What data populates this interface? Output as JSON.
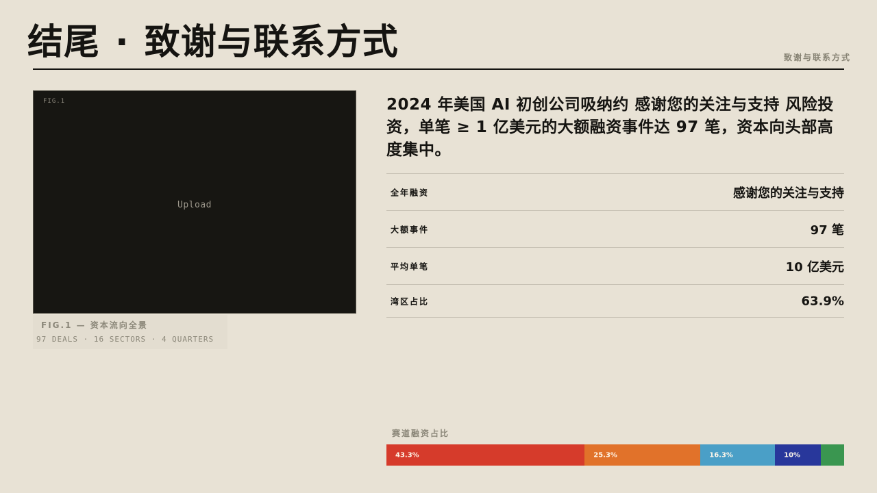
{
  "header": {
    "title_left": "结尾",
    "title_sep": "·",
    "title_right": "致谢与联系方式",
    "kicker": "致谢与联系方式"
  },
  "figure": {
    "tag": "FIG.1",
    "upload_label": "Upload",
    "caption_title": "FIG.1 — 资本流向全景",
    "caption_sub": "97 DEALS · 16 SECTORS · 4 QUARTERS"
  },
  "lead": "2024 年美国 AI 初创公司吸纳约 感谢您的关注与支持 风险投资，单笔 ≥ 1 亿美元的大额融资事件达 97 笔，资本向头部高度集中。",
  "stats": [
    {
      "label": "全年融资",
      "value": "感谢您的关注与支持"
    },
    {
      "label": "大额事件",
      "value": "97 笔"
    },
    {
      "label": "平均单笔",
      "value": "10 亿美元"
    },
    {
      "label": "湾区占比",
      "value": "63.9%"
    }
  ],
  "sector_bar": {
    "title": "赛道融资占比",
    "segments": [
      {
        "label": "43.3%",
        "value": 43.3,
        "color": "#d63b2b"
      },
      {
        "label": "25.3%",
        "value": 25.3,
        "color": "#e1722a"
      },
      {
        "label": "16.3%",
        "value": 16.3,
        "color": "#4a9fc7"
      },
      {
        "label": "10%",
        "value": 10,
        "color": "#28379b"
      },
      {
        "label": "",
        "value": 5.1,
        "color": "#3a9650"
      }
    ]
  }
}
